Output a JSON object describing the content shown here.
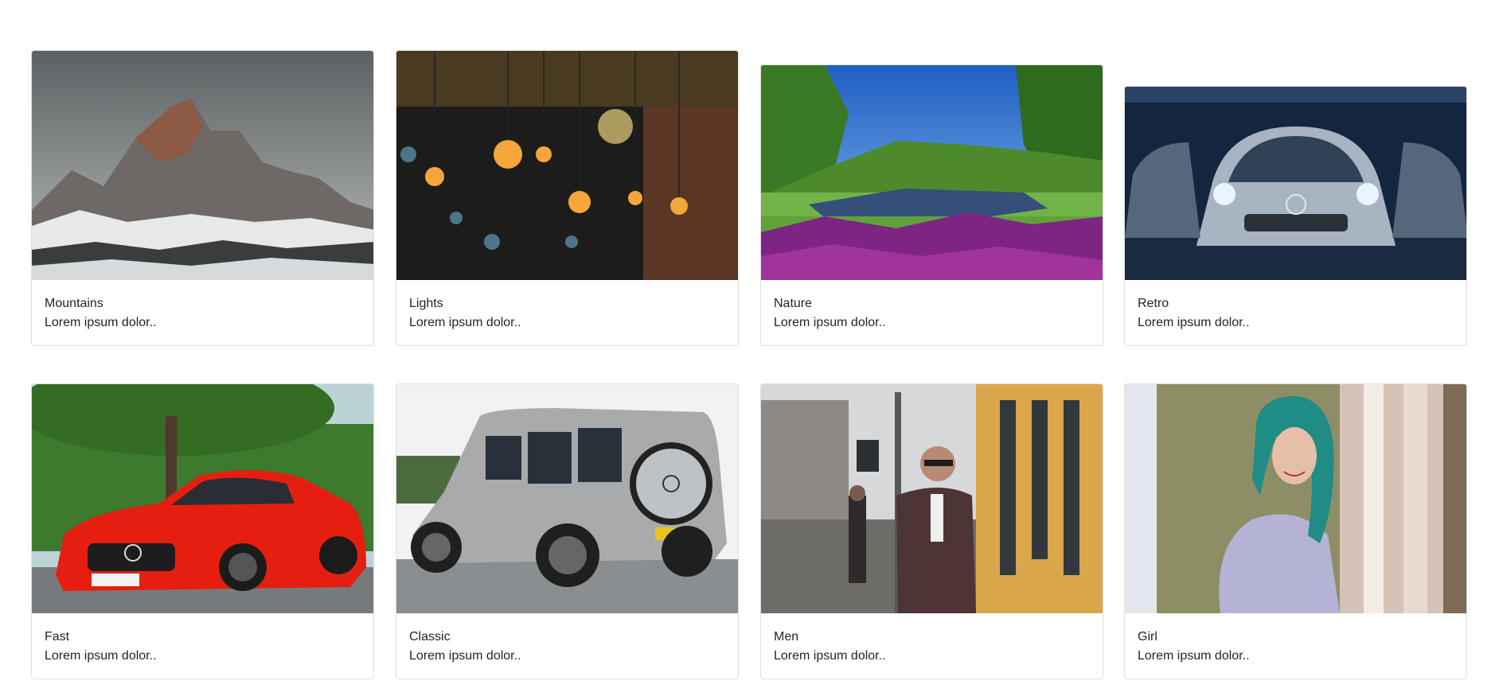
{
  "cards": [
    {
      "title": "Mountains",
      "text": "Lorem ipsum dolor..",
      "image": "snowy-mountain-photo"
    },
    {
      "title": "Lights",
      "text": "Lorem ipsum dolor..",
      "image": "hanging-bulbs-photo"
    },
    {
      "title": "Nature",
      "text": "Lorem ipsum dolor..",
      "image": "park-river-photo"
    },
    {
      "title": "Retro",
      "text": "Lorem ipsum dolor..",
      "image": "silver-cars-photo"
    },
    {
      "title": "Fast",
      "text": "Lorem ipsum dolor..",
      "image": "red-sports-car-photo"
    },
    {
      "title": "Classic",
      "text": "Lorem ipsum dolor..",
      "image": "silver-suv-photo"
    },
    {
      "title": "Men",
      "text": "Lorem ipsum dolor..",
      "image": "man-on-phone-street-photo"
    },
    {
      "title": "Girl",
      "text": "Lorem ipsum dolor..",
      "image": "green-hair-woman-photo"
    }
  ]
}
